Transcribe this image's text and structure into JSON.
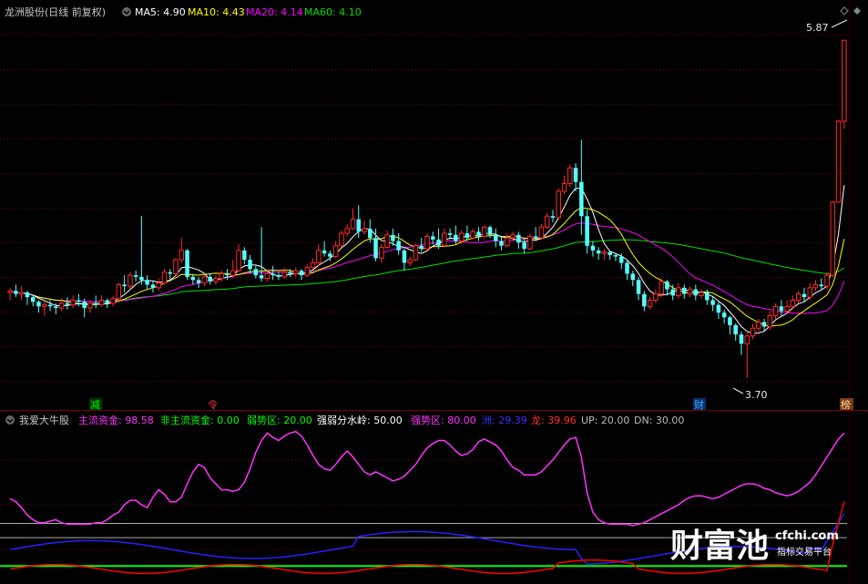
{
  "colors": {
    "background": "#000000",
    "up": "#ff2a2a",
    "down": "#54ffff",
    "ma5": "#ffffff",
    "ma10": "#ffff00",
    "ma20": "#ff00ff",
    "ma60": "#00e000",
    "grid": "#7a0000",
    "main_flow": "#ff33ff",
    "nonmain_flow": "#00ff00",
    "weak_line": "#00ff00",
    "strong_weak_line": "#bbbbbb",
    "blue_line": "#2222ff",
    "red_line": "#ff0000"
  },
  "price_panel": {
    "title": "龙洲股份(日线 前复权)",
    "indicators": [
      {
        "label": "MA5: 4.90",
        "color": "#ffffff"
      },
      {
        "label": "MA10: 4.43",
        "color": "#ffff00"
      },
      {
        "label": "MA20: 4.14",
        "color": "#ff00ff"
      },
      {
        "label": "MA60: 4.10",
        "color": "#00e000"
      }
    ],
    "high_label": "5.87",
    "low_label": "3.70",
    "price_range": [
      3.6,
      6.0
    ],
    "markers": [
      {
        "text": "减",
        "color": "#00ff00",
        "style": "green"
      },
      {
        "text": "令",
        "color": "#ff3333",
        "style": "red"
      },
      {
        "text": "财",
        "color": "#4fa0ff",
        "style": "blue"
      },
      {
        "text": "榜",
        "color": "#ffcc88",
        "style": "brown"
      }
    ]
  },
  "indicator_panel": {
    "title": "我爱大牛股",
    "items": [
      {
        "label": "主流资金: 98.58",
        "color": "#ff33ff"
      },
      {
        "label": "非主流资金: 0.00",
        "color": "#00ff00"
      },
      {
        "label": "弱势区: 20.00",
        "color": "#00ff00"
      },
      {
        "label": "强弱分水岭: 50.00",
        "color": "#ffffff"
      },
      {
        "label": "强势区: 80.00",
        "color": "#ff33ff"
      },
      {
        "label": "洲: 29.39",
        "color": "#3333ff"
      },
      {
        "label": "龙: 39.96",
        "color": "#ff3333"
      },
      {
        "label": "UP: 20.00",
        "color": "#bbbbbb"
      },
      {
        "label": "DN: 30.00",
        "color": "#bbbbbb"
      }
    ],
    "value_range": [
      0,
      100
    ]
  },
  "watermark": {
    "brand": "财富池",
    "url": "cfchi.com",
    "tagline": "指标交易平台"
  },
  "chart_data": {
    "type": "candlestick",
    "candles": [
      [
        4.25,
        4.26,
        4.2,
        4.28
      ],
      [
        4.26,
        4.24,
        4.22,
        4.3
      ],
      [
        4.24,
        4.25,
        4.2,
        4.29
      ],
      [
        4.25,
        4.22,
        4.17,
        4.26
      ],
      [
        4.22,
        4.19,
        4.16,
        4.23
      ],
      [
        4.19,
        4.16,
        4.12,
        4.2
      ],
      [
        4.16,
        4.17,
        4.1,
        4.19
      ],
      [
        4.17,
        4.16,
        4.13,
        4.2
      ],
      [
        4.16,
        4.15,
        4.11,
        4.18
      ],
      [
        4.15,
        4.18,
        4.13,
        4.21
      ],
      [
        4.18,
        4.17,
        4.14,
        4.22
      ],
      [
        4.17,
        4.2,
        4.15,
        4.23
      ],
      [
        4.2,
        4.19,
        4.16,
        4.24
      ],
      [
        4.19,
        4.15,
        4.09,
        4.21
      ],
      [
        4.15,
        4.18,
        4.12,
        4.2
      ],
      [
        4.18,
        4.17,
        4.15,
        4.23
      ],
      [
        4.17,
        4.2,
        4.16,
        4.23
      ],
      [
        4.2,
        4.18,
        4.15,
        4.21
      ],
      [
        4.18,
        4.21,
        4.16,
        4.23
      ],
      [
        4.21,
        4.3,
        4.2,
        4.31
      ],
      [
        4.3,
        4.29,
        4.25,
        4.36
      ],
      [
        4.29,
        4.36,
        4.27,
        4.38
      ],
      [
        4.36,
        4.35,
        4.32,
        4.39
      ],
      [
        4.35,
        4.33,
        4.3,
        4.74
      ],
      [
        4.33,
        4.3,
        4.27,
        4.36
      ],
      [
        4.3,
        4.28,
        4.25,
        4.32
      ],
      [
        4.28,
        4.31,
        4.26,
        4.34
      ],
      [
        4.31,
        4.38,
        4.3,
        4.4
      ],
      [
        4.38,
        4.37,
        4.32,
        4.4
      ],
      [
        4.37,
        4.46,
        4.36,
        4.47
      ],
      [
        4.46,
        4.52,
        4.44,
        4.6
      ],
      [
        4.52,
        4.35,
        4.33,
        4.53
      ],
      [
        4.35,
        4.33,
        4.3,
        4.37
      ],
      [
        4.33,
        4.31,
        4.28,
        4.35
      ],
      [
        4.31,
        4.35,
        4.29,
        4.36
      ],
      [
        4.35,
        4.32,
        4.3,
        4.37
      ],
      [
        4.32,
        4.34,
        4.3,
        4.36
      ],
      [
        4.34,
        4.37,
        4.32,
        4.39
      ],
      [
        4.37,
        4.36,
        4.33,
        4.4
      ],
      [
        4.36,
        4.39,
        4.34,
        4.46
      ],
      [
        4.39,
        4.52,
        4.38,
        4.56
      ],
      [
        4.52,
        4.46,
        4.43,
        4.54
      ],
      [
        4.46,
        4.4,
        4.37,
        4.49
      ],
      [
        4.4,
        4.36,
        4.34,
        4.42
      ],
      [
        4.36,
        4.34,
        4.32,
        4.67
      ],
      [
        4.34,
        4.37,
        4.32,
        4.39
      ],
      [
        4.37,
        4.36,
        4.33,
        4.42
      ],
      [
        4.36,
        4.35,
        4.33,
        4.38
      ],
      [
        4.35,
        4.38,
        4.34,
        4.41
      ],
      [
        4.38,
        4.37,
        4.35,
        4.4
      ],
      [
        4.37,
        4.39,
        4.35,
        4.41
      ],
      [
        4.39,
        4.36,
        4.33,
        4.4
      ],
      [
        4.36,
        4.41,
        4.35,
        4.43
      ],
      [
        4.41,
        4.44,
        4.4,
        4.47
      ],
      [
        4.44,
        4.52,
        4.42,
        4.56
      ],
      [
        4.52,
        4.5,
        4.48,
        4.58
      ],
      [
        4.5,
        4.48,
        4.45,
        4.52
      ],
      [
        4.48,
        4.55,
        4.47,
        4.58
      ],
      [
        4.55,
        4.63,
        4.54,
        4.65
      ],
      [
        4.63,
        4.66,
        4.61,
        4.69
      ],
      [
        4.66,
        4.72,
        4.65,
        4.79
      ],
      [
        4.72,
        4.64,
        4.6,
        4.81
      ],
      [
        4.64,
        4.66,
        4.62,
        4.71
      ],
      [
        4.66,
        4.6,
        4.57,
        4.72
      ],
      [
        4.6,
        4.47,
        4.45,
        4.66
      ],
      [
        4.47,
        4.54,
        4.44,
        4.56
      ],
      [
        4.54,
        4.62,
        4.53,
        4.65
      ],
      [
        4.62,
        4.58,
        4.55,
        4.66
      ],
      [
        4.58,
        4.52,
        4.49,
        4.63
      ],
      [
        4.52,
        4.44,
        4.39,
        4.53
      ],
      [
        4.44,
        4.46,
        4.42,
        4.48
      ],
      [
        4.46,
        4.55,
        4.45,
        4.56
      ],
      [
        4.55,
        4.53,
        4.51,
        4.6
      ],
      [
        4.53,
        4.61,
        4.52,
        4.63
      ],
      [
        4.61,
        4.59,
        4.56,
        4.64
      ],
      [
        4.59,
        4.55,
        4.53,
        4.66
      ],
      [
        4.55,
        4.63,
        4.54,
        4.66
      ],
      [
        4.63,
        4.62,
        4.59,
        4.66
      ],
      [
        4.62,
        4.58,
        4.56,
        4.68
      ],
      [
        4.58,
        4.63,
        4.56,
        4.65
      ],
      [
        4.63,
        4.6,
        4.58,
        4.68
      ],
      [
        4.6,
        4.64,
        4.59,
        4.66
      ],
      [
        4.64,
        4.61,
        4.58,
        4.67
      ],
      [
        4.61,
        4.67,
        4.6,
        4.68
      ],
      [
        4.67,
        4.62,
        4.6,
        4.68
      ],
      [
        4.62,
        4.58,
        4.54,
        4.66
      ],
      [
        4.58,
        4.55,
        4.52,
        4.61
      ],
      [
        4.55,
        4.6,
        4.54,
        4.63
      ],
      [
        4.6,
        4.62,
        4.58,
        4.64
      ],
      [
        4.62,
        4.57,
        4.53,
        4.64
      ],
      [
        4.57,
        4.53,
        4.5,
        4.6
      ],
      [
        4.53,
        4.61,
        4.52,
        4.63
      ],
      [
        4.61,
        4.6,
        4.58,
        4.67
      ],
      [
        4.6,
        4.67,
        4.59,
        4.69
      ],
      [
        4.67,
        4.74,
        4.66,
        4.76
      ],
      [
        4.74,
        4.73,
        4.7,
        4.78
      ],
      [
        4.73,
        4.9,
        4.72,
        4.92
      ],
      [
        4.9,
        4.95,
        4.88,
        5.0
      ],
      [
        4.95,
        5.05,
        4.93,
        5.07
      ],
      [
        5.05,
        4.96,
        4.9,
        5.08
      ],
      [
        4.96,
        4.74,
        4.62,
        5.23
      ],
      [
        4.74,
        4.55,
        4.5,
        4.78
      ],
      [
        4.55,
        4.52,
        4.48,
        4.58
      ],
      [
        4.52,
        4.5,
        4.46,
        4.54
      ],
      [
        4.5,
        4.51,
        4.46,
        4.53
      ],
      [
        4.51,
        4.49,
        4.46,
        4.52
      ],
      [
        4.49,
        4.48,
        4.45,
        4.5
      ],
      [
        4.48,
        4.44,
        4.4,
        4.5
      ],
      [
        4.44,
        4.37,
        4.33,
        4.46
      ],
      [
        4.37,
        4.33,
        4.29,
        4.39
      ],
      [
        4.33,
        4.24,
        4.2,
        4.35
      ],
      [
        4.24,
        4.16,
        4.13,
        4.26
      ],
      [
        4.16,
        4.2,
        4.14,
        4.22
      ],
      [
        4.2,
        4.24,
        4.18,
        4.27
      ],
      [
        4.24,
        4.32,
        4.22,
        4.34
      ],
      [
        4.32,
        4.27,
        4.23,
        4.33
      ],
      [
        4.27,
        4.23,
        4.2,
        4.3
      ],
      [
        4.23,
        4.28,
        4.21,
        4.31
      ],
      [
        4.28,
        4.24,
        4.21,
        4.3
      ],
      [
        4.24,
        4.27,
        4.22,
        4.29
      ],
      [
        4.27,
        4.23,
        4.2,
        4.3
      ],
      [
        4.23,
        4.25,
        4.21,
        4.27
      ],
      [
        4.25,
        4.2,
        4.17,
        4.27
      ],
      [
        4.2,
        4.17,
        4.13,
        4.22
      ],
      [
        4.17,
        4.12,
        4.08,
        4.19
      ],
      [
        4.12,
        4.09,
        4.05,
        4.14
      ],
      [
        4.09,
        4.04,
        3.98,
        4.1
      ],
      [
        4.04,
        3.98,
        3.94,
        4.05
      ],
      [
        3.98,
        3.92,
        3.85,
        4.0
      ],
      [
        3.92,
        3.97,
        3.7,
        3.99
      ],
      [
        3.97,
        4.02,
        3.95,
        4.05
      ],
      [
        4.02,
        4.06,
        4.0,
        4.08
      ],
      [
        4.06,
        4.03,
        4.0,
        4.08
      ],
      [
        4.03,
        4.1,
        4.01,
        4.13
      ],
      [
        4.1,
        4.16,
        4.08,
        4.18
      ],
      [
        4.16,
        4.13,
        4.1,
        4.2
      ],
      [
        4.13,
        4.16,
        4.11,
        4.2
      ],
      [
        4.16,
        4.2,
        4.14,
        4.23
      ],
      [
        4.2,
        4.24,
        4.18,
        4.26
      ],
      [
        4.24,
        4.22,
        4.19,
        4.28
      ],
      [
        4.22,
        4.28,
        4.2,
        4.31
      ],
      [
        4.28,
        4.3,
        4.26,
        4.33
      ],
      [
        4.3,
        4.29,
        4.27,
        4.34
      ],
      [
        4.29,
        4.36,
        4.27,
        4.38
      ],
      [
        4.36,
        4.83,
        4.35,
        4.84
      ],
      [
        4.83,
        5.35,
        4.83,
        5.36
      ],
      [
        5.35,
        5.87,
        5.3,
        5.87
      ]
    ],
    "ma_periods": [
      5,
      10,
      20,
      60
    ],
    "main_flow_series": [
      54,
      52,
      48,
      43,
      40,
      38,
      38,
      39,
      40,
      38,
      37,
      37,
      37,
      37,
      37,
      38,
      38,
      40,
      43,
      45,
      50,
      53,
      53,
      50,
      48,
      55,
      60,
      57,
      52,
      52,
      55,
      64,
      72,
      77,
      75,
      68,
      64,
      60,
      60,
      59,
      60,
      65,
      74,
      85,
      93,
      98,
      95,
      93,
      96,
      98,
      99,
      96,
      90,
      83,
      77,
      74,
      73,
      77,
      82,
      86,
      82,
      77,
      72,
      70,
      72,
      70,
      68,
      66,
      67,
      69,
      73,
      77,
      83,
      88,
      91,
      93,
      93,
      90,
      86,
      83,
      84,
      87,
      92,
      94,
      92,
      90,
      86,
      80,
      75,
      73,
      70,
      70,
      70,
      72,
      76,
      80,
      85,
      90,
      94,
      95,
      82,
      58,
      45,
      40,
      38,
      37,
      37,
      37,
      37,
      36,
      37,
      38,
      40,
      42,
      44,
      46,
      48,
      50,
      53,
      55,
      56,
      56,
      55,
      54,
      55,
      57,
      59,
      61,
      63,
      64,
      64,
      63,
      61,
      60,
      58,
      57,
      56,
      57,
      59,
      62,
      65,
      70,
      76,
      82,
      88,
      94,
      98
    ]
  }
}
